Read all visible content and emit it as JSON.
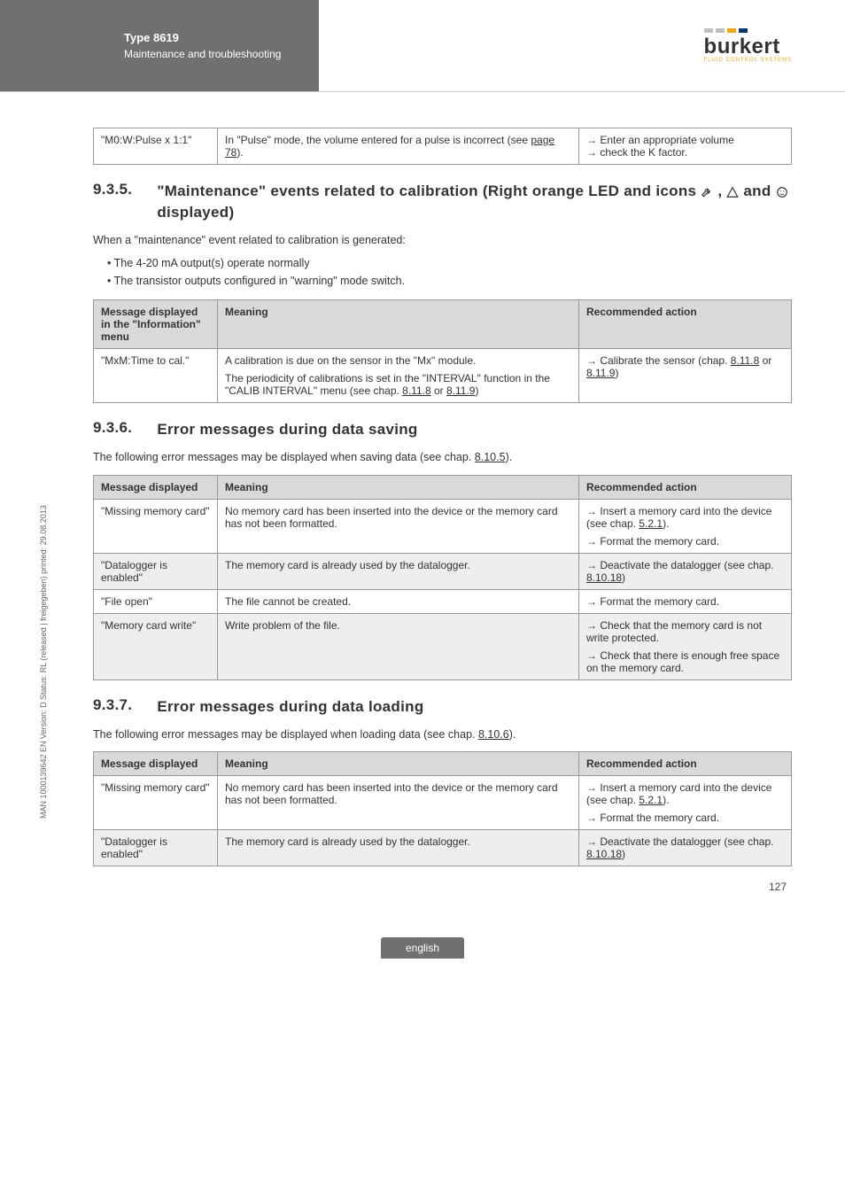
{
  "header": {
    "type": "Type 8619",
    "subtitle": "Maintenance and troubleshooting",
    "logo_text": "burkert",
    "logo_tag": "FLUID CONTROL SYSTEMS"
  },
  "sidetext": "MAN 1000139642 EN Version: D Status: RL (released | freigegeben) printed: 29.08.2013",
  "tableTop": {
    "r0c0": "\"M0:W:Pulse x 1:1\"",
    "r0c1a": "In \"Pulse\" mode, the volume entered for a pulse is incorrect (see ",
    "r0c1b": "page 78",
    "r0c1c": ").",
    "r0c2a": "Enter an appropriate volume",
    "r0c2b": "check the K factor."
  },
  "sec935": {
    "num": "9.3.5.",
    "title_a": "\"Maintenance\" events related to calibration (Right orange LED and icons ",
    "title_b": ", ",
    "title_c": " and ",
    "title_d": " displayed)",
    "p1": "When a \"maintenance\" event related to calibration is generated:",
    "b1": "The 4-20 mA output(s) operate normally",
    "b2": "The transistor outputs configured in \"warning\" mode switch."
  },
  "table935": {
    "h1": "Message displayed in the \"Information\" menu",
    "h2": "Meaning",
    "h3": "Recommended action",
    "r0c0": "\"MxM:Time to cal.\"",
    "r0c1a": "A calibration is due on the sensor in the \"Mx\" module.",
    "r0c1b": "The periodicity of calibrations is set in the \"INTERVAL\" function in the \"CALIB INTERVAL\" menu (see chap. ",
    "r0c1c": "8.11.8",
    "r0c1d": " or ",
    "r0c1e": "8.11.9",
    "r0c1f": ")",
    "r0c2a": "Calibrate the sensor (chap. ",
    "r0c2b": "8.11.8",
    "r0c2c": " or ",
    "r0c2d": "8.11.9",
    "r0c2e": ")"
  },
  "sec936": {
    "num": "9.3.6.",
    "title": "Error messages during data saving",
    "p1a": "The following error messages may be displayed when saving data (see chap.  ",
    "p1b": "8.10.5",
    "p1c": ")."
  },
  "table936": {
    "h1": "Message displayed",
    "h2": "Meaning",
    "h3": "Recommended action",
    "r0c0": "\"Missing memory card\"",
    "r0c1": "No memory card has been inserted into the device or the memory card has not been formatted.",
    "r0c2a": "Insert a memory card into the device (see chap. ",
    "r0c2b": "5.2.1",
    "r0c2c": ").",
    "r0c2d": "Format the memory card.",
    "r1c0": "\"Datalogger is enabled\"",
    "r1c1": "The memory card is already used by the datalogger.",
    "r1c2a": "Deactivate the datalogger (see chap. ",
    "r1c2b": "8.10.18",
    "r1c2c": ")",
    "r2c0": "\"File open\"",
    "r2c1": "The file cannot be created.",
    "r2c2": "Format the memory card.",
    "r3c0": "\"Memory card write\"",
    "r3c1": "Write problem of the file.",
    "r3c2a": "Check that the memory card is not write protected.",
    "r3c2b": "Check that there is enough free space on the memory card."
  },
  "sec937": {
    "num": "9.3.7.",
    "title": "Error messages during data loading",
    "p1a": "The following error messages may be displayed when loading data (see chap. ",
    "p1b": "8.10.6",
    "p1c": ")."
  },
  "table937": {
    "h1": "Message displayed",
    "h2": "Meaning",
    "h3": "Recommended action",
    "r0c0": "\"Missing memory card\"",
    "r0c1": "No memory card has been inserted into the device or the memory card has not been formatted.",
    "r0c2a": "Insert a memory card into the device (see chap. ",
    "r0c2b": "5.2.1",
    "r0c2c": ").",
    "r0c2d": "Format the memory card.",
    "r1c0": "\"Datalogger is enabled\"",
    "r1c1": "The memory card is already used by the datalogger.",
    "r1c2a": "Deactivate the datalogger (see chap. ",
    "r1c2b": "8.10.18",
    "r1c2c": ")"
  },
  "footer": {
    "lang": "english",
    "page": "127"
  }
}
